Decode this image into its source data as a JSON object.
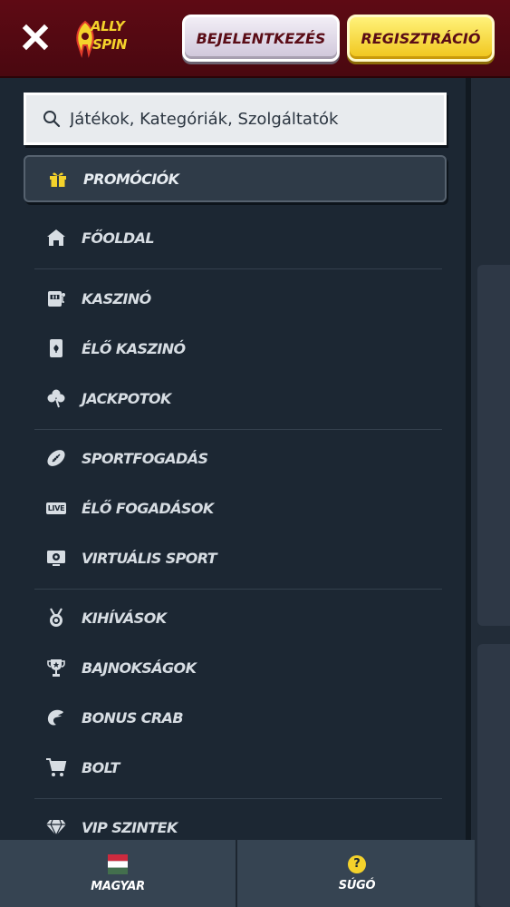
{
  "header": {
    "logo_line1": "ALLY",
    "logo_line2": "SPIN",
    "login_label": "BEJELENTKEZÉS",
    "register_label": "REGISZTRÁCIÓ"
  },
  "search": {
    "placeholder": "Játékok, Kategóriák, Szolgáltatók",
    "icon": "search-icon"
  },
  "menu": {
    "promo": {
      "label": "PROMÓCIÓK",
      "icon": "gift-icon"
    },
    "groups": [
      [
        {
          "label": "FŐOLDAL",
          "icon": "home-icon"
        }
      ],
      [
        {
          "label": "KASZINÓ",
          "icon": "slot-machine-icon"
        },
        {
          "label": "ÉLŐ KASZINÓ",
          "icon": "playing-card-icon"
        },
        {
          "label": "JACKPOTOK",
          "icon": "clover-icon"
        }
      ],
      [
        {
          "label": "SPORTFOGADÁS",
          "icon": "football-icon"
        },
        {
          "label": "ÉLŐ FOGADÁSOK",
          "icon": "live-icon"
        },
        {
          "label": "VIRTUÁLIS SPORT",
          "icon": "virtual-sport-icon"
        }
      ],
      [
        {
          "label": "KIHÍVÁSOK",
          "icon": "medal-icon"
        },
        {
          "label": "BAJNOKSÁGOK",
          "icon": "trophy-icon"
        },
        {
          "label": "BONUS CRAB",
          "icon": "crab-claw-icon"
        },
        {
          "label": "BOLT",
          "icon": "cart-icon"
        }
      ],
      [
        {
          "label": "VIP SZINTEK",
          "icon": "diamond-icon"
        }
      ]
    ],
    "live_badge": "LIVE"
  },
  "footer": {
    "language_label": "MAGYAR",
    "language_icon": "hungarian-flag-icon",
    "help_label": "SÚGÓ",
    "help_glyph": "?",
    "help_icon": "help-icon"
  },
  "colors": {
    "header_bg": "#5e0a14",
    "menu_bg": "#1c2733",
    "accent_yellow": "#f4d22b",
    "text": "#d7dde3"
  }
}
